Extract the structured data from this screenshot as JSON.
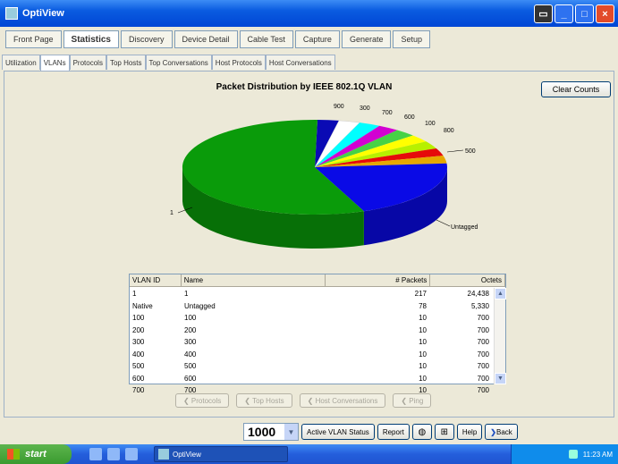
{
  "window": {
    "title": "OptiView"
  },
  "main_tabs": [
    "Front Page",
    "Statistics",
    "Discovery",
    "Device Detail",
    "Cable Test",
    "Capture",
    "Generate",
    "Setup"
  ],
  "main_tab_active": 1,
  "sub_tabs": [
    "Utilization",
    "VLANs",
    "Protocols",
    "Top Hosts",
    "Top Conversations",
    "Host Protocols",
    "Host Conversations"
  ],
  "sub_tab_active": 1,
  "clear_counts_label": "Clear Counts",
  "chart_data": {
    "type": "pie",
    "title": "Packet Distribution by IEEE 802.1Q VLAN",
    "categories": [
      "1",
      "Untagged",
      "100",
      "200",
      "300",
      "400",
      "500",
      "600",
      "700",
      "800",
      "900"
    ],
    "values": [
      217,
      78,
      10,
      10,
      10,
      10,
      10,
      10,
      10,
      10,
      10
    ],
    "colors": [
      "#0A9B0A",
      "#0A0AE6",
      "#E6A800",
      "#E60A0A",
      "#B7F000",
      "#FFFF00",
      "#46D246",
      "#D200D2",
      "#00FFFF",
      "#FFFFFF",
      "#0A0AB4"
    ],
    "labels_visible": [
      "900",
      "300",
      "700",
      "600",
      "100",
      "800",
      "500",
      "1",
      "Untagged"
    ]
  },
  "table": {
    "columns": [
      "VLAN ID",
      "Name",
      "# Packets",
      "Octets"
    ],
    "rows": [
      {
        "id": "1",
        "name": "1",
        "packets": "217",
        "octets": "24,438"
      },
      {
        "id": "Native",
        "name": "Untagged",
        "packets": "78",
        "octets": "5,330"
      },
      {
        "id": "100",
        "name": "100",
        "packets": "10",
        "octets": "700"
      },
      {
        "id": "200",
        "name": "200",
        "packets": "10",
        "octets": "700"
      },
      {
        "id": "300",
        "name": "300",
        "packets": "10",
        "octets": "700"
      },
      {
        "id": "400",
        "name": "400",
        "packets": "10",
        "octets": "700"
      },
      {
        "id": "500",
        "name": "500",
        "packets": "10",
        "octets": "700"
      },
      {
        "id": "600",
        "name": "600",
        "packets": "10",
        "octets": "700"
      },
      {
        "id": "700",
        "name": "700",
        "packets": "10",
        "octets": "700"
      }
    ]
  },
  "nav_buttons": [
    "Protocols",
    "Top Hosts",
    "Host Conversations",
    "Ping"
  ],
  "bottom": {
    "combo_value": "1000",
    "active_vlan_label": "Active VLAN Status",
    "report_label": "Report",
    "help_label": "Help",
    "back_label": "Back"
  },
  "taskbar": {
    "start_label": "start",
    "task_label": "OptiView",
    "clock": "11:23 AM"
  }
}
